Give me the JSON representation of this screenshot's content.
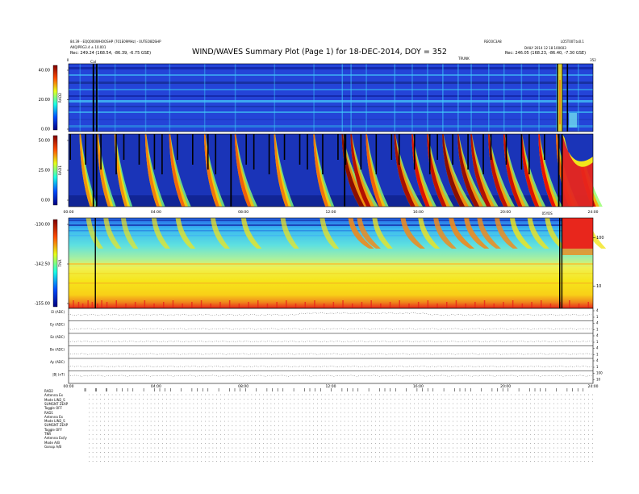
{
  "title": "WIND/WAVES Summary Plot (Page 1) for 18-DEC-2014, DOY = 352",
  "header": {
    "left_line1": "84.39 - EQQ000WHOOSHP (701E09MHz) - 0UTEO8DSHP",
    "left_line2": "AKQ/PRG3.4 ± 10.001",
    "left_position": "Rec:   249.24 (168.54, -86.39, -6.75 GSE)",
    "center_small": "TRUNK",
    "right_top1": "REO0C3A8",
    "right_top2": "LO5T00T.to0.1",
    "right_mid": "DAILY  2014 12 18 100603",
    "right_position": "Rec:   246.05 (168.23, -86.40, -7.30 GSE)",
    "corner_left": "0",
    "corner_right": "352",
    "cal_label": "Cal"
  },
  "colors": {
    "background_field": "#1f3fc8",
    "burst_low": "#21c7d8",
    "burst_mid": "#f2e51a",
    "burst_high": "#e8261c",
    "tnr_orange": "#f08a1c"
  },
  "chart_data": [
    {
      "type": "heatmap",
      "name": "RAD2",
      "ylabel": "RAD2",
      "ylim": [
        0,
        40
      ],
      "yticks": [
        "40.00",
        "20.00",
        "0.00"
      ],
      "colorbar": [
        "low",
        "high"
      ]
    },
    {
      "type": "heatmap",
      "name": "RAD1",
      "ylabel": "RAD1",
      "ylim": [
        0,
        50
      ],
      "yticks": [
        "50.00",
        "25.00",
        "0.00"
      ],
      "xticks": [
        "00:00",
        "04:00",
        "08:00",
        "12:00",
        "16:00",
        "20:00",
        "24:00"
      ],
      "x_end_label": "05YOS",
      "burst_times_h": [
        0.5,
        1.3,
        2.1,
        3.5,
        4.6,
        6.2,
        7.6,
        9.4,
        11.2,
        12.5,
        12.9,
        13.6,
        14.9,
        15.7,
        16.4,
        17.1,
        17.8,
        18.4,
        19.2,
        19.9,
        20.7,
        21.5,
        22.3,
        23.3
      ],
      "burst_strength": [
        0.35,
        0.4,
        0.35,
        0.45,
        0.55,
        0.5,
        0.6,
        0.45,
        0.5,
        1.0,
        0.85,
        0.6,
        0.9,
        0.7,
        0.8,
        1.0,
        0.95,
        0.85,
        0.8,
        0.75,
        0.7,
        0.65,
        0.6,
        0.7
      ]
    },
    {
      "type": "heatmap",
      "name": "TNR",
      "ylabel": "TNR",
      "ylim": [
        -155,
        -130
      ],
      "yticks": [
        "-130.00",
        "-142.50",
        "-155.00"
      ],
      "right_ticks": [
        "100",
        "10"
      ]
    },
    {
      "type": "line",
      "name": "Aux traces",
      "rows": [
        {
          "label": "El (ADC)",
          "ticks": [
            "4",
            "1"
          ]
        },
        {
          "label": "Ey (ADC)",
          "ticks": [
            "4",
            "1"
          ]
        },
        {
          "label": "Ez (ADC)",
          "ticks": [
            "4",
            "1"
          ]
        },
        {
          "label": "Bx (ADC)",
          "ticks": [
            "4",
            "1"
          ]
        },
        {
          "label": "Ay (ADC)",
          "ticks": [
            "4",
            "1"
          ]
        },
        {
          "label": "|B| (nT)",
          "ticks": [
            "100",
            "10"
          ]
        }
      ],
      "xticks": [
        "00:00",
        "04:00",
        "08:00",
        "12:00",
        "16:00",
        "20:00",
        "24:00"
      ]
    }
  ],
  "footer": {
    "lines": [
      "RAD2",
      "Antenna     Ex",
      "Mode    LIN2_S",
      "SUMGNT    ZEAP",
      "Toggle    OFF",
      "RAD1",
      "Antenna     Ex",
      "Mode    LIN2_S",
      "SUMGNT    ZEAP",
      "Toggle    OFF",
      "TNR",
      "Antenna     Ex/ly",
      "Mode    A/B",
      "Gonop    A/B"
    ]
  }
}
